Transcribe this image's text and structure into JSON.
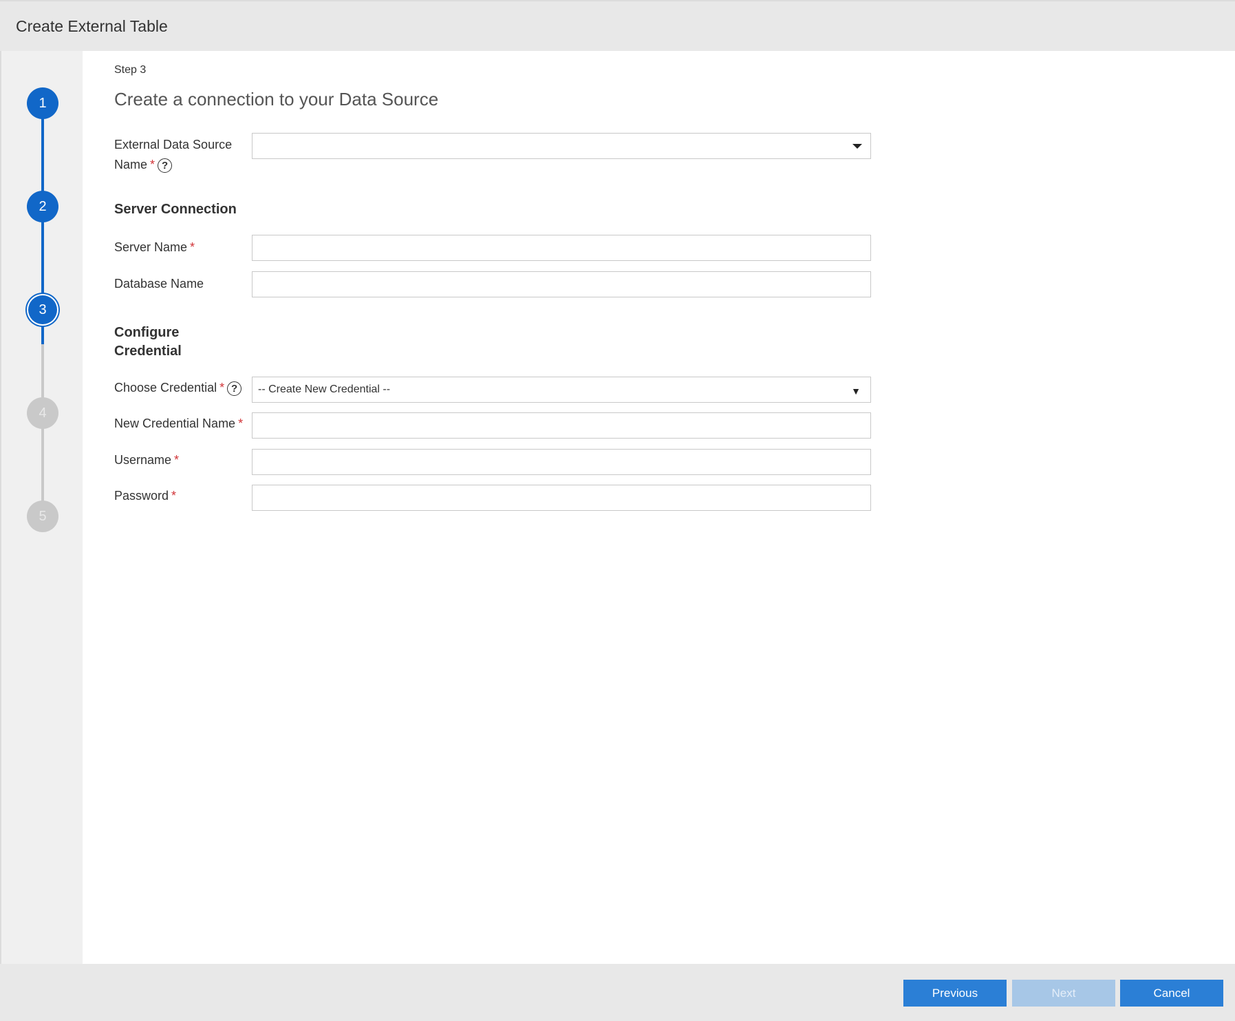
{
  "window": {
    "title": "Create External Table"
  },
  "stepper": {
    "steps": [
      {
        "label": "1",
        "state": "done"
      },
      {
        "label": "2",
        "state": "done"
      },
      {
        "label": "3",
        "state": "active"
      },
      {
        "label": "4",
        "state": "todo"
      },
      {
        "label": "5",
        "state": "todo"
      }
    ],
    "active_color": "#1167c8",
    "inactive_color": "#c9c9c9"
  },
  "main": {
    "step_label": "Step 3",
    "title": "Create a connection to your Data Source",
    "external_data_source": {
      "label_line1": "External Data Source",
      "label_line2": "Name",
      "required": "*",
      "help": "?",
      "value": ""
    },
    "server_connection": {
      "heading": "Server Connection",
      "server_name_label": "Server Name",
      "server_name_required": "*",
      "server_name_value": "",
      "database_name_label": "Database Name",
      "database_name_value": ""
    },
    "credential": {
      "heading_line1": "Configure",
      "heading_line2": "Credential",
      "choose_label": "Choose Credential",
      "choose_required": "*",
      "choose_help": "?",
      "choose_selected": "-- Create New Credential --",
      "new_name_label": "New Credential Name",
      "new_name_required": "*",
      "new_name_value": "",
      "username_label": "Username",
      "username_required": "*",
      "username_value": "",
      "password_label": "Password",
      "password_required": "*",
      "password_value": ""
    }
  },
  "footer": {
    "previous_label": "Previous",
    "next_label": "Next",
    "cancel_label": "Cancel",
    "button_color": "#2b7fd6"
  }
}
